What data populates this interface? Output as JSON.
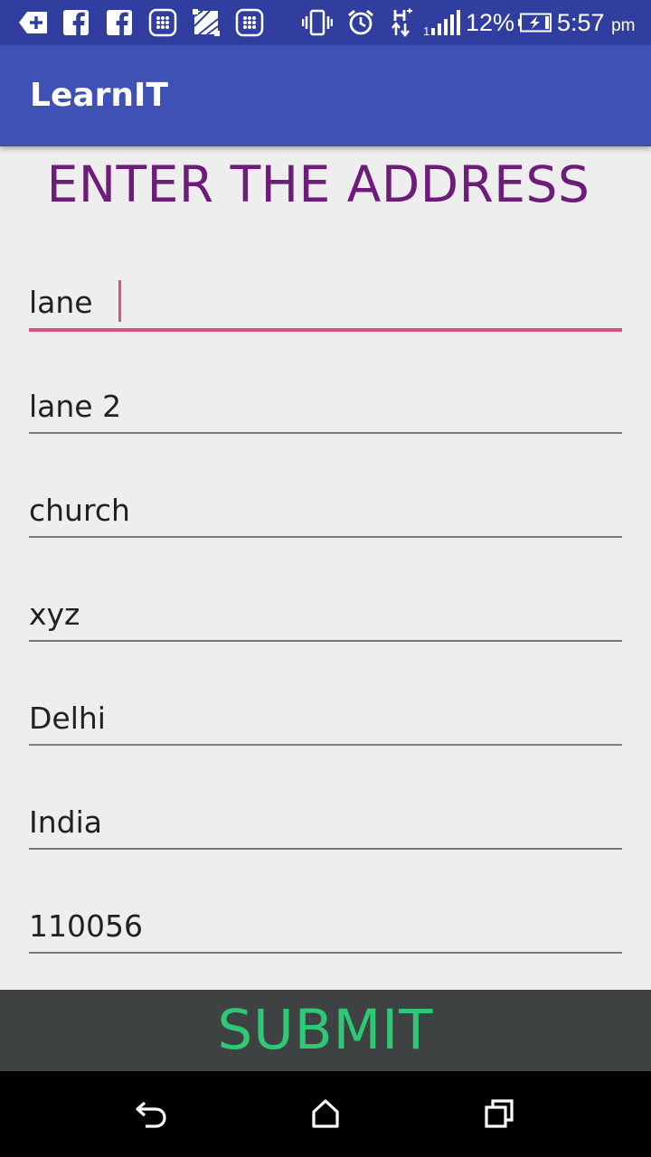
{
  "status_bar": {
    "battery_percent": "12%",
    "time": "5:57",
    "ampm": "pm",
    "icons": [
      "notification-plus-icon",
      "facebook-icon",
      "facebook-icon",
      "app-grid-icon",
      "gallery-icon",
      "app-grid-icon",
      "vibrate-icon",
      "alarm-icon",
      "hplus-data-icon",
      "signal-icon",
      "battery-charging-icon"
    ]
  },
  "app_bar": {
    "title": "LearnIT"
  },
  "form": {
    "heading": "ENTER THE ADDRESS",
    "fields": [
      {
        "value": "lane",
        "focused": true
      },
      {
        "value": "lane 2"
      },
      {
        "value": "church"
      },
      {
        "value": "xyz"
      },
      {
        "value": "Delhi"
      },
      {
        "value": "India"
      },
      {
        "value": "110056"
      }
    ],
    "submit_label": "SUBMIT"
  },
  "nav_bar": {
    "icons": [
      "back-icon",
      "home-icon",
      "recents-icon"
    ]
  },
  "colors": {
    "status_bar": "#303f9f",
    "app_bar": "#3f51b5",
    "heading": "#6e1c7a",
    "accent": "#e0507e",
    "submit_bg": "#3e4243",
    "submit_text": "#2fc975"
  }
}
